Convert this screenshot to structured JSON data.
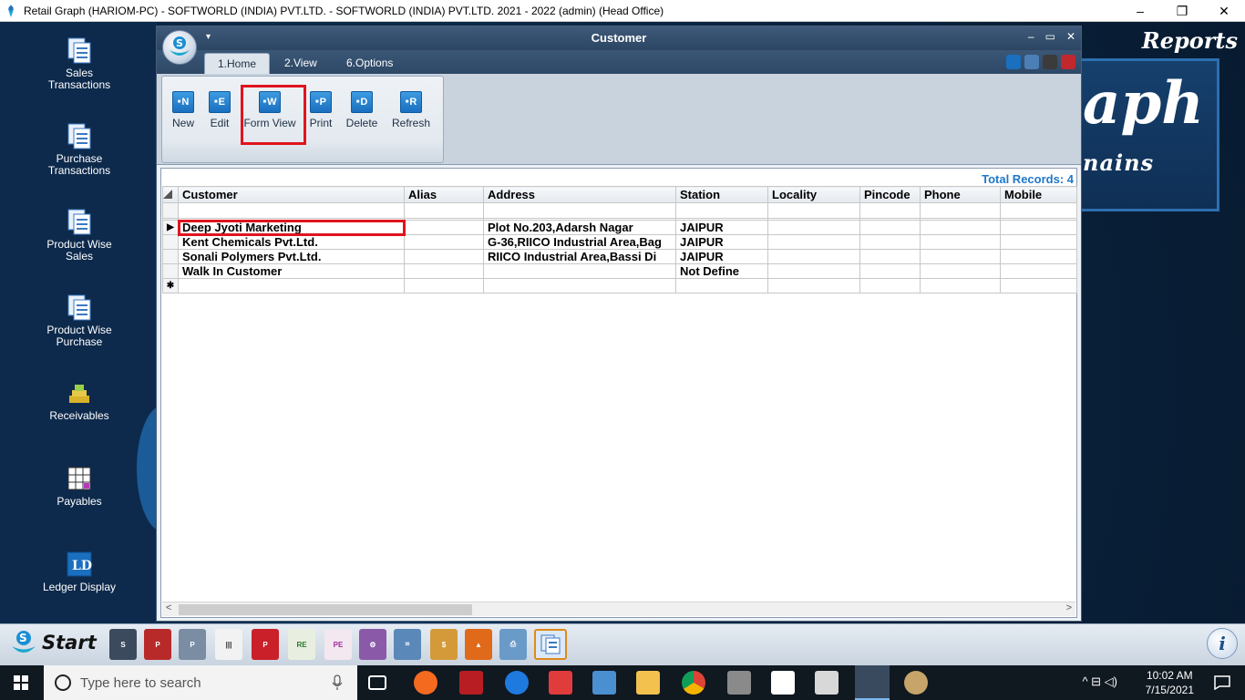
{
  "os_window": {
    "title": "Retail Graph (HARIOM-PC) - SOFTWORLD (INDIA) PVT.LTD. - SOFTWORLD (INDIA) PVT.LTD.  2021 - 2022 (admin) (Head Office)",
    "minimize": "–",
    "maximize": "❐",
    "close": "✕"
  },
  "desktop": {
    "reports_label": "Reports",
    "logo_line1": "aph",
    "logo_line2": "nains",
    "icons": [
      {
        "label": "Sales Transactions",
        "icon": "sales-transactions-icon"
      },
      {
        "label": "Purchase Transactions",
        "icon": "purchase-transactions-icon"
      },
      {
        "label": "Product Wise Sales",
        "icon": "product-wise-sales-icon"
      },
      {
        "label": "Product Wise Purchase",
        "icon": "product-wise-purchase-icon"
      },
      {
        "label": "Receivables",
        "icon": "receivables-icon"
      },
      {
        "label": "Payables",
        "icon": "payables-icon"
      },
      {
        "label": "Ledger Display",
        "icon": "ledger-display-icon"
      }
    ]
  },
  "window": {
    "title": "Customer",
    "controls": {
      "minimize": "–",
      "maximize": "▭",
      "close": "✕"
    },
    "qat_arrow": "▾",
    "orb_letter": "S",
    "tabs": [
      {
        "label": "1.Home",
        "active": true
      },
      {
        "label": "2.View",
        "active": false
      },
      {
        "label": "6.Options",
        "active": false
      }
    ],
    "ribbon": {
      "buttons": [
        {
          "label": "New",
          "letter": "N"
        },
        {
          "label": "Edit",
          "letter": "E"
        },
        {
          "label": "Form View",
          "letter": "W",
          "highlighted": true
        },
        {
          "label": "Print",
          "letter": "P"
        },
        {
          "label": "Delete",
          "letter": "D"
        },
        {
          "label": "Refresh",
          "letter": "R"
        }
      ]
    },
    "total_records": "Total Records: 4",
    "grid": {
      "columns": [
        "Customer",
        "Alias",
        "Address",
        "Station",
        "Locality",
        "Pincode",
        "Phone",
        "Mobile"
      ],
      "rows": [
        {
          "customer": "Deep Jyoti Marketing",
          "alias": "",
          "address": "Plot No.203,Adarsh Nagar",
          "station": "JAIPUR",
          "locality": "",
          "pincode": "",
          "phone": "",
          "mobile": "",
          "current": true
        },
        {
          "customer": "Kent Chemicals Pvt.Ltd.",
          "alias": "",
          "address": "G-36,RIICO Industrial Area,Bag",
          "station": "JAIPUR",
          "locality": "",
          "pincode": "",
          "phone": "",
          "mobile": "",
          "current": false
        },
        {
          "customer": "Sonali Polymers Pvt.Ltd.",
          "alias": "",
          "address": "RIICO Industrial Area,Bassi Di",
          "station": "JAIPUR",
          "locality": "",
          "pincode": "",
          "phone": "",
          "mobile": "",
          "current": false
        },
        {
          "customer": "Walk In Customer",
          "alias": "",
          "address": "",
          "station": "Not Define",
          "locality": "",
          "pincode": "",
          "phone": "",
          "mobile": "",
          "current": false
        }
      ],
      "current_row_marker": "▶",
      "new_row_marker": "✱"
    }
  },
  "app_taskbar": {
    "start_label": "Start",
    "icons": [
      "sales-icon",
      "purchase-icon",
      "pos-icon",
      "barcode-icon",
      "stock-icon",
      "pos-register-icon",
      "receipt-entry-icon",
      "payment-entry-icon",
      "tools-icon",
      "calculator-tools-icon",
      "money-bag-icon",
      "shapes-icon",
      "printer-icon",
      "customer-icon"
    ],
    "info_label": "i"
  },
  "win_taskbar": {
    "search_placeholder": "Type here to search",
    "time": "10:02 AM",
    "date": "7/15/2021",
    "tray": "^ ⊟ ◁)"
  },
  "colors": {
    "accent_blue": "#1e78c8",
    "highlight_red": "#e0141e",
    "window_titlebar": "#2b4563"
  }
}
